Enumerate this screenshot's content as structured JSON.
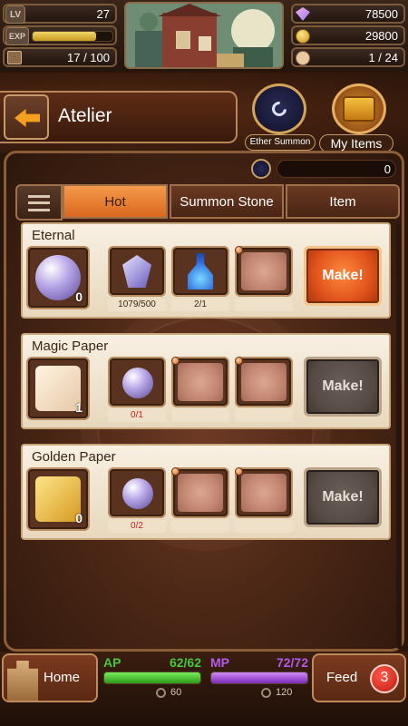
{
  "hud": {
    "lv_label": "LV",
    "lv_value": "27",
    "exp_label": "EXP",
    "exp_fraction": 0.8,
    "storage_value": "17 / 100",
    "gems_value": "78500",
    "gold_value": "29800",
    "friends_value": "1 / 24"
  },
  "header": {
    "title": "Atelier",
    "ether_summon_label": "Ether Summon",
    "my_items_label": "My Items"
  },
  "ether_count": "0",
  "tabs": [
    "Hot",
    "Summon Stone",
    "Item"
  ],
  "recipes": [
    {
      "title": "Eternal",
      "result_count": "0",
      "materials": [
        {
          "icon": "crystal-icon",
          "label": "1079/500",
          "ok": true
        },
        {
          "icon": "potion-icon",
          "label": "2/1",
          "ok": true
        },
        {
          "icon": "",
          "label": "",
          "ok": true
        }
      ],
      "make_label": "Make!",
      "make_enabled": true
    },
    {
      "title": "Magic Paper",
      "result_count": "1",
      "materials": [
        {
          "icon": "pearl-icon",
          "label": "0/1",
          "ok": false
        },
        {
          "icon": "",
          "label": "",
          "ok": true
        },
        {
          "icon": "",
          "label": "",
          "ok": true
        }
      ],
      "make_label": "Make!",
      "make_enabled": false
    },
    {
      "title": "Golden Paper",
      "result_count": "0",
      "materials": [
        {
          "icon": "pearl-icon",
          "label": "0/2",
          "ok": false
        },
        {
          "icon": "",
          "label": "",
          "ok": true
        },
        {
          "icon": "",
          "label": "",
          "ok": true
        }
      ],
      "make_label": "Make!",
      "make_enabled": false
    }
  ],
  "bottom": {
    "home_label": "Home",
    "ap_label": "AP",
    "ap_value": "62/62",
    "ap_fraction": 1.0,
    "ap_timer": "60",
    "mp_label": "MP",
    "mp_value": "72/72",
    "mp_fraction": 1.0,
    "mp_timer": "120",
    "feed_label": "Feed",
    "feed_count": "3"
  },
  "colors": {
    "accent_orange": "#e0521c",
    "ap_green": "#46c83a",
    "mp_purple": "#a04ad8",
    "error_red": "#c82020"
  }
}
